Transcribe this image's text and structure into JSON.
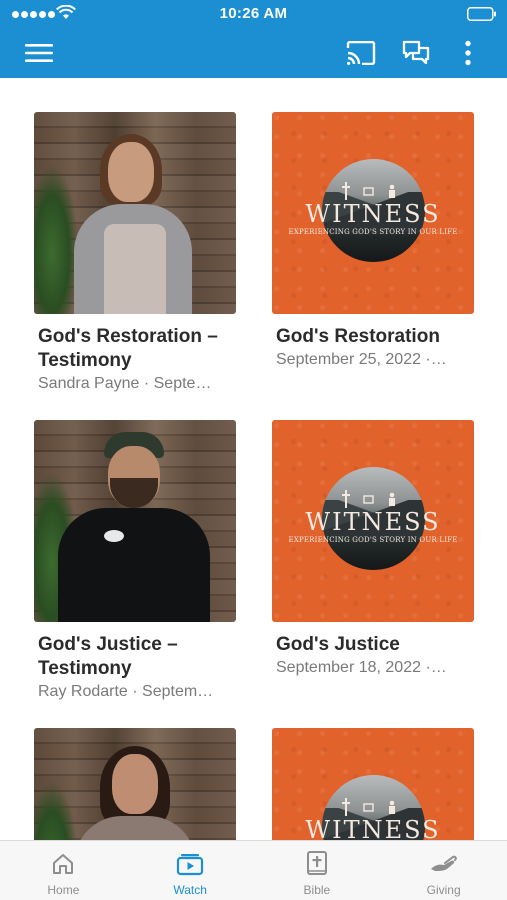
{
  "status_bar": {
    "time": "10:26 AM"
  },
  "app_bar": {
    "menu_icon": "hamburger-menu-icon",
    "cast_icon": "cast-icon",
    "chat_icon": "chat-bubbles-icon",
    "more_icon": "more-vertical-icon",
    "color": "#1b8fd1"
  },
  "witness_graphic": {
    "word": "WITNESS",
    "tagline": "EXPERIENCING GOD'S STORY IN OUR LIFE",
    "color": "#e2622b"
  },
  "videos": [
    {
      "title": "God's Restoration – Testimony",
      "subtitle": "Sandra Payne · Septe…",
      "thumbnail": "person-photo"
    },
    {
      "title": "God's Restoration",
      "subtitle": "September 25, 2022 ·…",
      "thumbnail": "witness-graphic"
    },
    {
      "title": "God's Justice – Testimony",
      "subtitle": "Ray Rodarte · Septem…",
      "thumbnail": "person-photo"
    },
    {
      "title": "God's Justice",
      "subtitle": "September 18, 2022 ·…",
      "thumbnail": "witness-graphic"
    },
    {
      "title": "",
      "subtitle": "",
      "thumbnail": "person-photo"
    },
    {
      "title": "",
      "subtitle": "",
      "thumbnail": "witness-graphic"
    }
  ],
  "bottom_nav": {
    "items": [
      {
        "label": "Home",
        "icon": "home-icon",
        "active": false
      },
      {
        "label": "Watch",
        "icon": "watch-video-icon",
        "active": true
      },
      {
        "label": "Bible",
        "icon": "bible-icon",
        "active": false
      },
      {
        "label": "Giving",
        "icon": "giving-hand-icon",
        "active": false
      }
    ],
    "active_color": "#1b8fd1",
    "inactive_color": "#8e8e8e"
  }
}
